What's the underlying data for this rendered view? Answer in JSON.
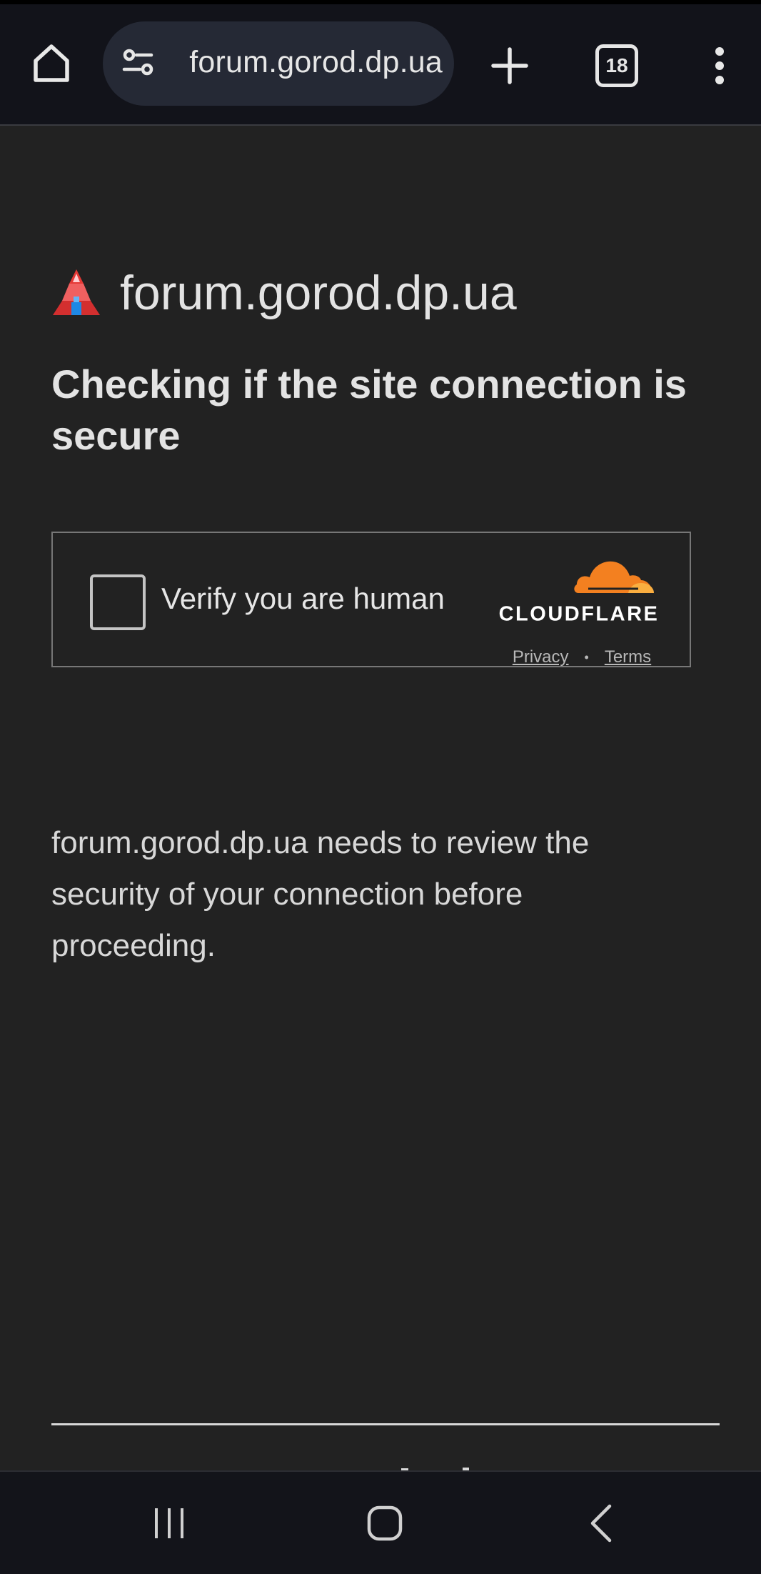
{
  "browser": {
    "url_display": "forum.gorod.dp.ua",
    "tab_count": "18",
    "icons": {
      "home": "home-icon",
      "site_settings": "tune-icon",
      "new_tab": "plus-icon",
      "tabs": "tab-switcher-icon",
      "menu": "more-vert-icon"
    }
  },
  "page": {
    "site_name": "forum.gorod.dp.ua",
    "heading": "Checking if the site connection is secure",
    "description": "forum.gorod.dp.ua needs to review the security of your connection before proceeding."
  },
  "challenge": {
    "checkbox_label": "Verify you are human",
    "checked": false,
    "brand": "CLOUDFLARE",
    "privacy_link": "Privacy",
    "separator": "•",
    "terms_link": "Terms"
  },
  "system_nav": {
    "icons": [
      "recents-icon",
      "home-icon",
      "back-icon"
    ]
  },
  "colors": {
    "page_background": "#222222",
    "toolbar_background": "#12131a",
    "url_pill": "#252935",
    "cloudflare_orange": "#f38020",
    "cloudflare_light_orange": "#faae40",
    "text": "#e3e3e3"
  }
}
